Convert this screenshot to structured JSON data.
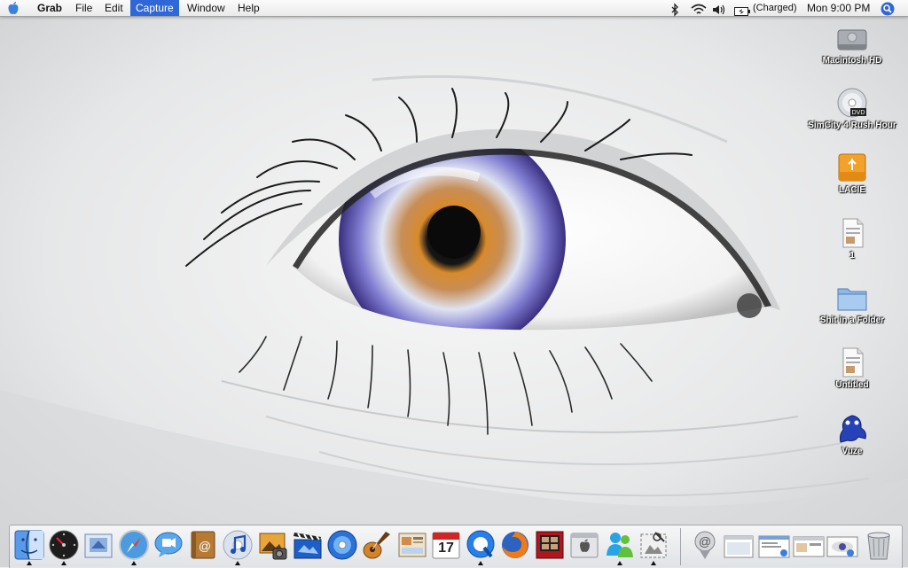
{
  "menubar": {
    "app_name": "Grab",
    "menus": [
      "File",
      "Edit",
      "Capture",
      "Window",
      "Help"
    ],
    "active_menu": "Capture",
    "battery_status": "(Charged)",
    "clock": "Mon 9:00 PM",
    "icons": [
      "apple-logo-icon",
      "bluetooth-icon",
      "wifi-icon",
      "volume-icon",
      "battery-icon",
      "spotlight-icon"
    ]
  },
  "desktop": {
    "items": [
      {
        "label": "Macintosh HD",
        "icon": "hard-drive-icon"
      },
      {
        "label": "SimCity 4 Rush Hour",
        "icon": "dvd-disc-icon"
      },
      {
        "label": "LACIE",
        "icon": "usb-drive-icon"
      },
      {
        "label": "1",
        "icon": "document-icon"
      },
      {
        "label": "Shit in a Folder",
        "icon": "folder-icon"
      },
      {
        "label": "Untitled",
        "icon": "document-icon"
      },
      {
        "label": "Vuze",
        "icon": "vuze-frog-icon"
      }
    ],
    "wallpaper": "close-up eye photograph"
  },
  "dock": {
    "calendar_day": "17",
    "apps": [
      "finder-icon",
      "dashboard-icon",
      "mail-icon",
      "safari-icon",
      "ichat-icon",
      "address-book-icon",
      "itunes-icon",
      "iphoto-icon",
      "imovie-icon",
      "idvd-icon",
      "garageband-icon",
      "iweb-icon",
      "ical-icon",
      "quicktime-icon",
      "firefox-icon",
      "photo-booth-icon",
      "system-preferences-icon",
      "msn-messenger-icon",
      "grab-icon"
    ],
    "right_items": [
      "mail-stack-icon",
      "minimized-window-icon",
      "minimized-window-icon",
      "minimized-window-icon",
      "minimized-window-icon",
      "trash-icon"
    ]
  },
  "colors": {
    "menu_highlight": "#2f67d8",
    "iris_blue": "#5a4fb0",
    "iris_orange": "#d88a2c"
  }
}
